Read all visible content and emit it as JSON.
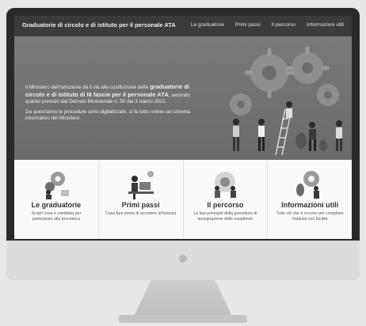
{
  "site": {
    "title": "Graduatorie di circolo e di istituto per il personale ATA"
  },
  "nav": [
    {
      "label": "Le graduatorie"
    },
    {
      "label": "Primi passi"
    },
    {
      "label": "Il percorso"
    },
    {
      "label": "Informazioni utili"
    }
  ],
  "hero": {
    "p1_pre": "Il Ministero dell'Istruzione dà il via alla costituzione delle ",
    "p1_bold": "graduatorie di circolo e di istituto di III fascia per il personale ATA",
    "p1_post": ", secondo quanto previsto dal Decreto Ministeriale n. 50 del 3 marzo 2021.",
    "p2": "Da quest'anno le procedure sono digitalizzate, si fa tutto online sul sistema informativo del Ministero."
  },
  "cards": [
    {
      "title": "Le graduatorie",
      "desc": "Scopri cosa è cambiato per partecipare alla procedura"
    },
    {
      "title": "Primi passi",
      "desc": "Cosa fare prima di accedere all'istanza"
    },
    {
      "title": "Il percorso",
      "desc": "Le fasi principali della procedura di assegnazione delle supplenze"
    },
    {
      "title": "Informazioni utili",
      "desc": "Tutto ciò che ti occorre per compilare l'istanza con facilità"
    }
  ]
}
